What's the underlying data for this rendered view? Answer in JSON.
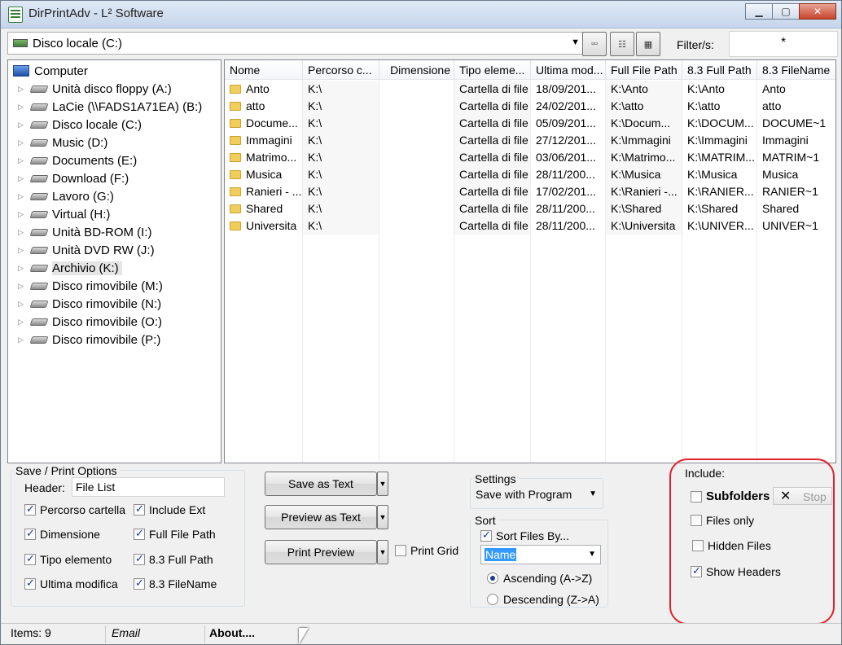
{
  "window": {
    "title": "DirPrintAdv - L² Software"
  },
  "toolbar": {
    "drive": "Disco locale (C:)",
    "filter_label": "Filter/s:",
    "filter_value": "*",
    "view_icons": [
      "details-view-icon",
      "list-view-icon",
      "grid-view-icon"
    ]
  },
  "tree": {
    "root": "Computer",
    "items": [
      "Unità disco floppy (A:)",
      "LaCie (\\\\FADS1A71EA) (B:)",
      "Disco locale (C:)",
      "Music (D:)",
      "Documents (E:)",
      "Download (F:)",
      "Lavoro (G:)",
      "Virtual (H:)",
      "Unità BD-ROM (I:)",
      "Unità DVD RW (J:)",
      "Archivio (K:)",
      "Disco rimovibile (M:)",
      "Disco rimovibile (N:)",
      "Disco rimovibile (O:)",
      "Disco rimovibile (P:)"
    ],
    "selected": "Archivio (K:)"
  },
  "filelist": {
    "columns": [
      "Nome",
      "Percorso c...",
      "Dimensione",
      "Tipo eleme...",
      "Ultima mod...",
      "Full File Path",
      "8.3 Full Path",
      "8.3 FileName"
    ],
    "rows": [
      [
        "Anto",
        "K:\\",
        "",
        "Cartella di file",
        "18/09/201...",
        "K:\\Anto",
        "K:\\Anto",
        "Anto"
      ],
      [
        "atto",
        "K:\\",
        "",
        "Cartella di file",
        "24/02/201...",
        "K:\\atto",
        "K:\\atto",
        "atto"
      ],
      [
        "Docume...",
        "K:\\",
        "",
        "Cartella di file",
        "05/09/201...",
        "K:\\Docum...",
        "K:\\DOCUM...",
        "DOCUME~1"
      ],
      [
        "Immagini",
        "K:\\",
        "",
        "Cartella di file",
        "27/12/201...",
        "K:\\Immagini",
        "K:\\Immagini",
        "Immagini"
      ],
      [
        "Matrimo...",
        "K:\\",
        "",
        "Cartella di file",
        "03/06/201...",
        "K:\\Matrimo...",
        "K:\\MATRIM...",
        "MATRIM~1"
      ],
      [
        "Musica",
        "K:\\",
        "",
        "Cartella di file",
        "28/11/200...",
        "K:\\Musica",
        "K:\\Musica",
        "Musica"
      ],
      [
        "Ranieri - ...",
        "K:\\",
        "",
        "Cartella di file",
        "17/02/201...",
        "K:\\Ranieri -...",
        "K:\\RANIER...",
        "RANIER~1"
      ],
      [
        "Shared",
        "K:\\",
        "",
        "Cartella di file",
        "28/11/200...",
        "K:\\Shared",
        "K:\\Shared",
        "Shared"
      ],
      [
        "Universita",
        "K:\\",
        "",
        "Cartella di file",
        "28/11/200...",
        "K:\\Universita",
        "K:\\UNIVER...",
        "UNIVER~1"
      ]
    ]
  },
  "options": {
    "group_title": "Save / Print Options",
    "header_label": "Header:",
    "header_value": "File List",
    "left_checks": [
      {
        "label": "Percorso cartella",
        "checked": true
      },
      {
        "label": "Dimensione",
        "checked": true
      },
      {
        "label": "Tipo elemento",
        "checked": true
      },
      {
        "label": "Ultima modifica",
        "checked": true
      }
    ],
    "right_checks": [
      {
        "label": "Include Ext",
        "checked": true
      },
      {
        "label": "Full File Path",
        "checked": true
      },
      {
        "label": "8.3 Full Path",
        "checked": true
      },
      {
        "label": "8.3 FileName",
        "checked": true
      }
    ]
  },
  "actions": {
    "save_as_text": "Save as Text",
    "preview_as_text": "Preview as Text",
    "print_preview": "Print Preview",
    "print_grid": "Print Grid"
  },
  "settings": {
    "title": "Settings",
    "mode": "Save with Program"
  },
  "sort": {
    "title": "Sort",
    "sort_by_label": "Sort Files By...",
    "sort_by_value": "Name",
    "ascending": "Ascending (A->Z)",
    "descending": "Descending (Z->A)"
  },
  "include": {
    "title": "Include:",
    "subfolders": "Subfolders",
    "stop": "Stop",
    "files_only": "Files only",
    "hidden_files": "Hidden Files",
    "show_headers": "Show Headers"
  },
  "status": {
    "items": "Items: 9",
    "email": "Email",
    "about": "About...."
  }
}
